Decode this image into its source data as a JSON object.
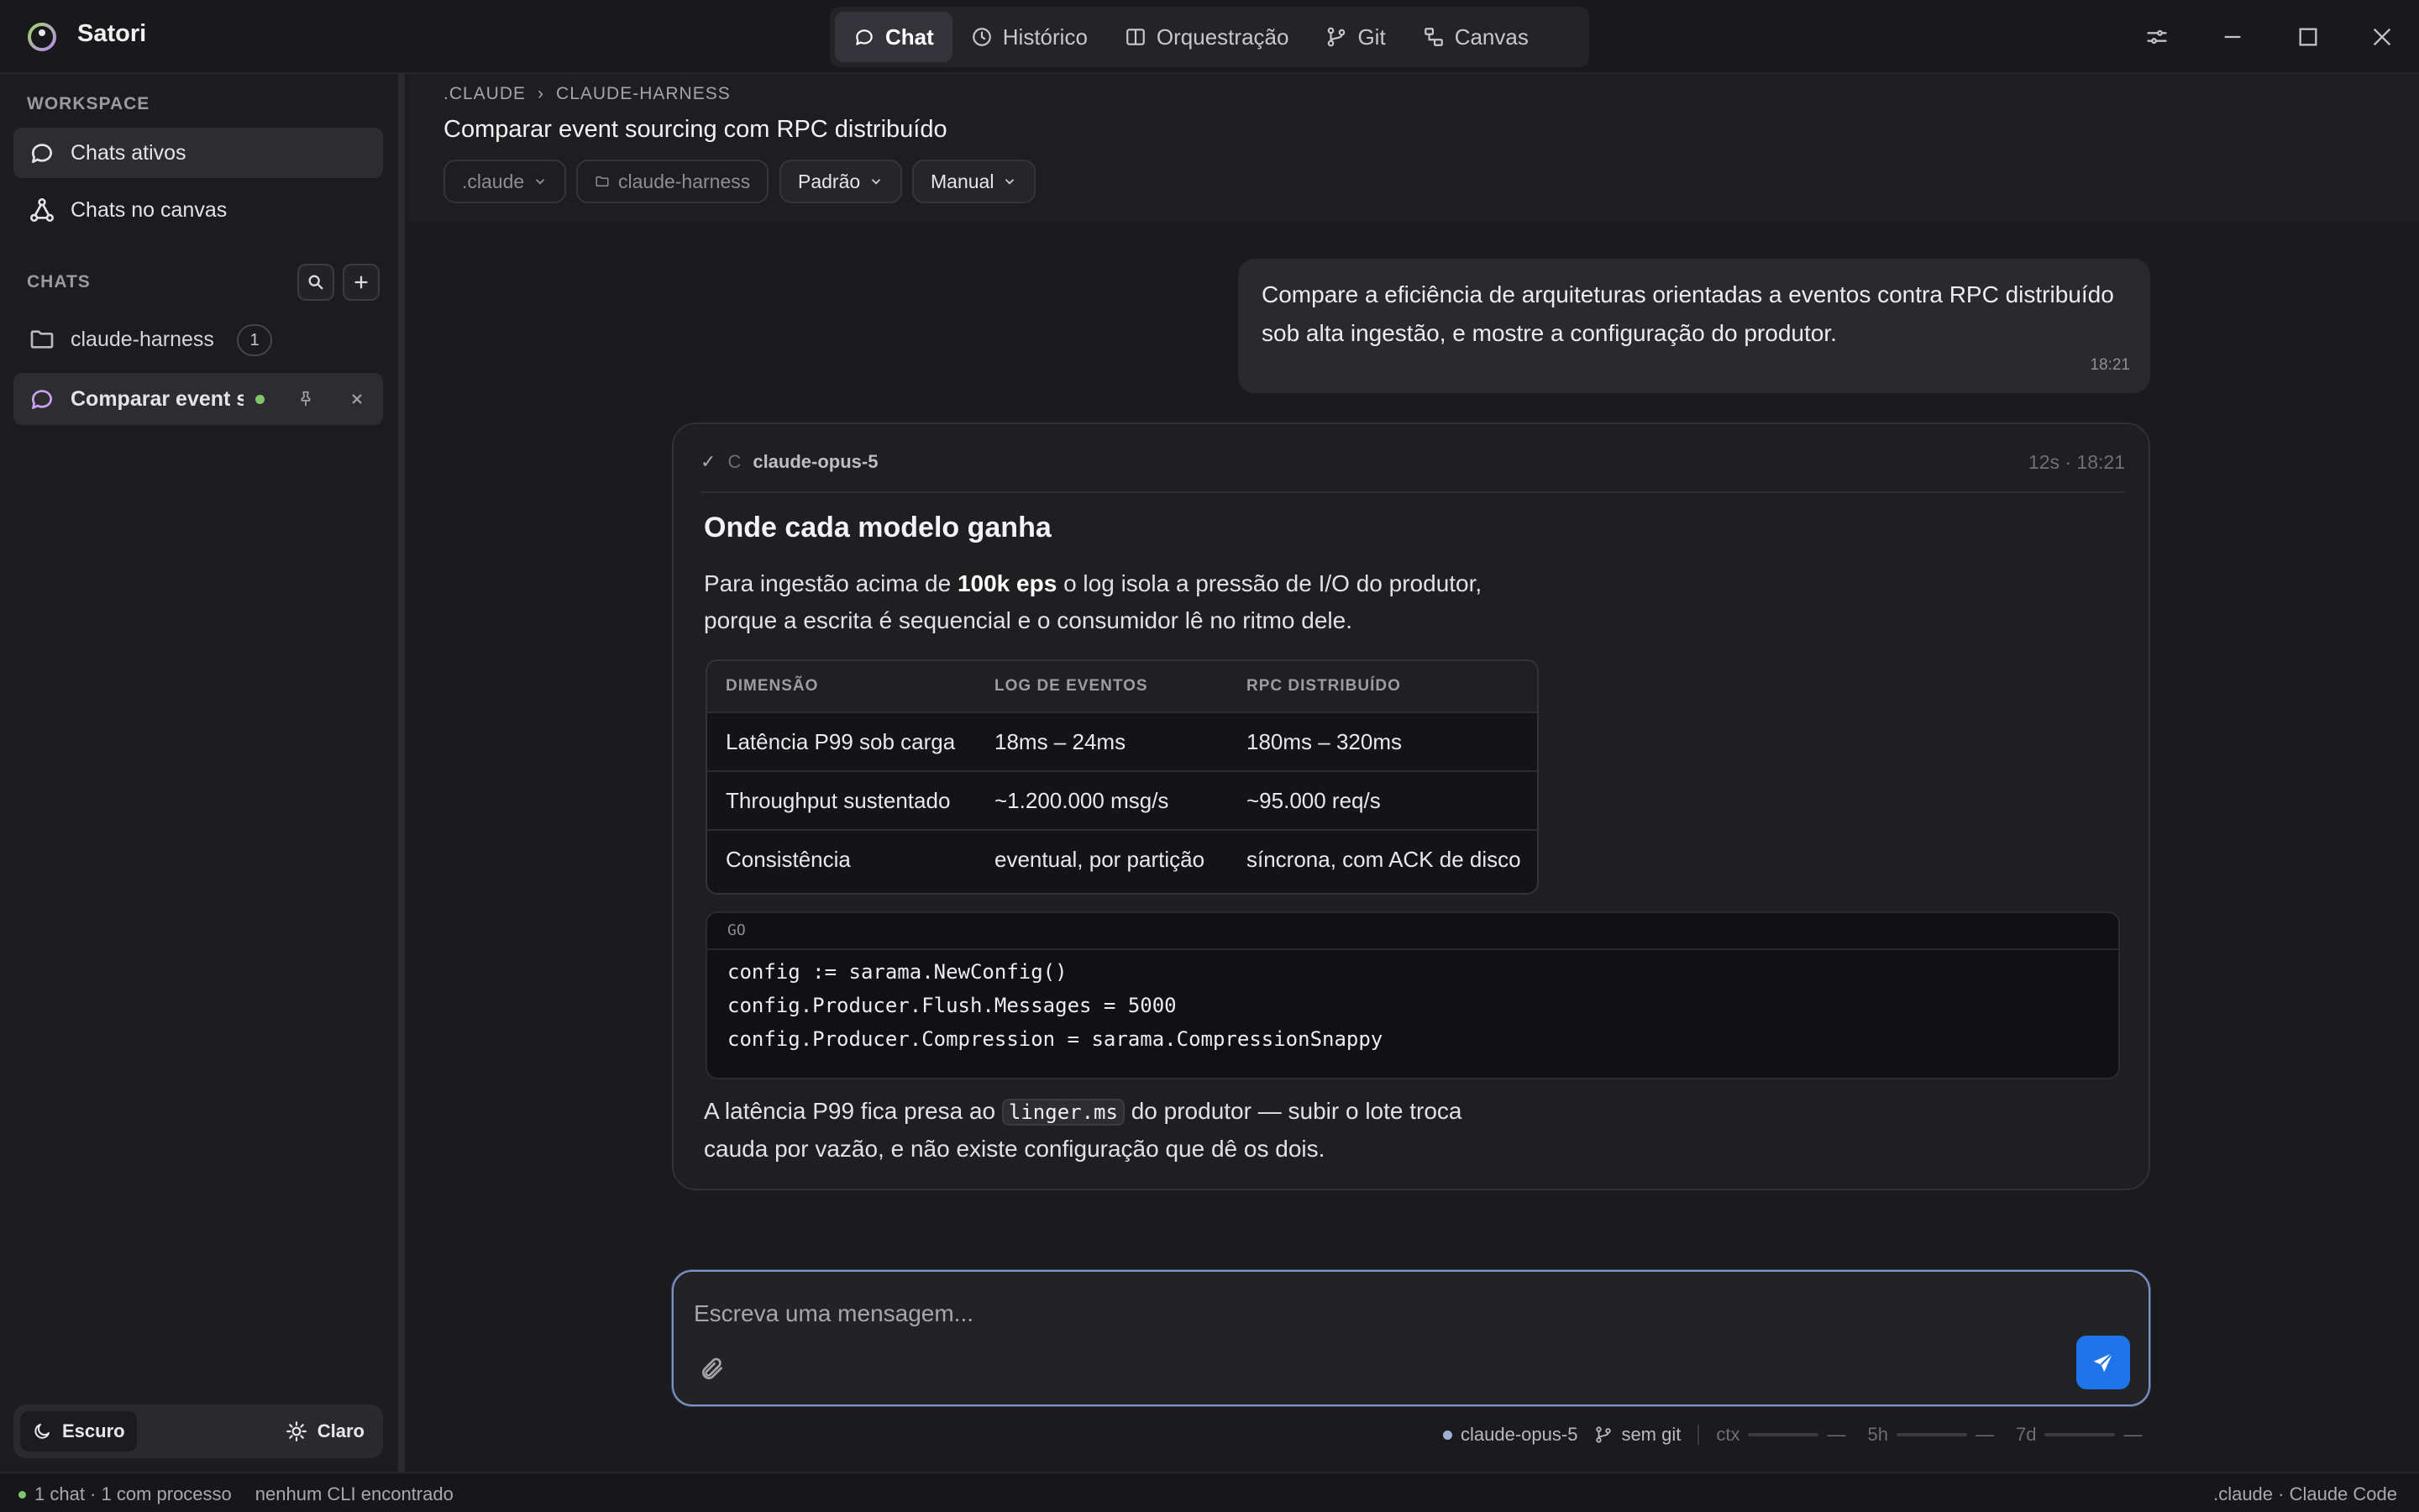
{
  "app": {
    "name": "Satori"
  },
  "nav": {
    "tabs": [
      {
        "label": "Chat",
        "icon": "chat-icon",
        "active": true
      },
      {
        "label": "Histórico",
        "icon": "clock-icon"
      },
      {
        "label": "Orquestração",
        "icon": "columns-icon"
      },
      {
        "label": "Git",
        "icon": "git-branch-icon"
      },
      {
        "label": "Canvas",
        "icon": "canvas-icon"
      }
    ]
  },
  "sidebar": {
    "workspace_label": "WORKSPACE",
    "items": [
      {
        "label": "Chats ativos",
        "icon": "chat-icon",
        "active": true
      },
      {
        "label": "Chats no canvas",
        "icon": "nodes-icon"
      }
    ],
    "chats_label": "CHATS",
    "folders": [
      {
        "label": "claude-harness",
        "count": "1"
      }
    ],
    "open_chat": {
      "label": "Comparar event s...",
      "status_color": "#7ec86b"
    },
    "theme": {
      "dark_label": "Escuro",
      "light_label": "Claro",
      "selected": "Escuro"
    }
  },
  "header": {
    "breadcrumb": [
      ".CLAUDE",
      "CLAUDE-HARNESS"
    ],
    "breadcrumb_separator": "›",
    "title": "Comparar event sourcing com RPC distribuído",
    "chips": [
      ".claude",
      "claude-harness",
      "Padrão",
      "Manual"
    ]
  },
  "user_message": {
    "text": "Compare a eficiência de arquiteturas orientadas a eventos contra RPC distribuído sob alta ingestão, e mostre a configuração do produtor.",
    "time": "18:21"
  },
  "assistant_message": {
    "check": "✓",
    "avatar": "C",
    "model": "claude-opus-5",
    "meta": "12s · 18:21",
    "heading": "Onde cada modelo ganha",
    "intro_before": "Para ingestão acima de ",
    "intro_bold": "100k eps",
    "intro_after": " o log isola a pressão de I/O do produtor, porque a escrita é sequencial e o consumidor lê no ritmo dele.",
    "table": {
      "headers": [
        "DIMENSÃO",
        "LOG DE EVENTOS",
        "RPC DISTRIBUÍDO"
      ],
      "rows": [
        [
          "Latência P99 sob carga",
          "18ms – 24ms",
          "180ms – 320ms"
        ],
        [
          "Throughput sustentado",
          "~1.200.000 msg/s",
          "~95.000 req/s"
        ],
        [
          "Consistência",
          "eventual, por partição",
          "síncrona, com ACK de disco"
        ]
      ]
    },
    "code": {
      "language": "GO",
      "lines": [
        "config := sarama.NewConfig()",
        "config.Producer.Flush.Messages = 5000",
        "config.Producer.Compression = sarama.CompressionSnappy"
      ]
    },
    "outro_before": "A latência P99 fica presa ao ",
    "outro_code": "linger.ms",
    "outro_after": " do produtor — subir o lote troca cauda por vazão, e não existe configuração que dê os dois."
  },
  "composer": {
    "placeholder": "Escreva uma mensagem...",
    "value": ""
  },
  "composer_meta": {
    "model": "claude-opus-5",
    "git": "sem git",
    "ctx_label": "ctx",
    "ctx_value": "—",
    "h5_label": "5h",
    "h5_value": "—",
    "d7_label": "7d",
    "d7_value": "—"
  },
  "status": {
    "chats": "1 chat · 1 com processo",
    "cli": "nenhum CLI encontrado",
    "right": ".claude · Claude Code"
  },
  "colors": {
    "accent": "#1e74e8",
    "status_ok": "#7ec86b",
    "focus_ring": "#7e93c4"
  }
}
